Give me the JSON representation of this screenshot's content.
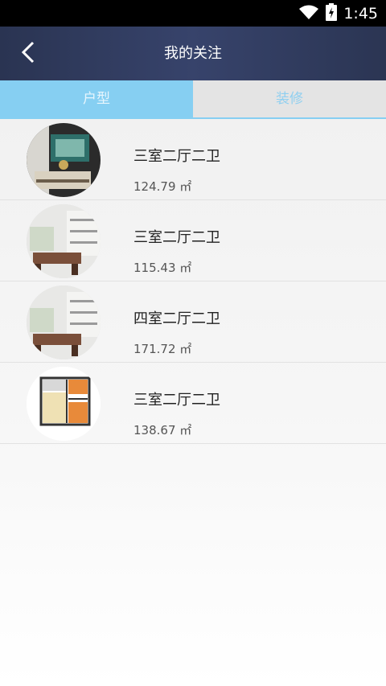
{
  "status_bar": {
    "time": "1:45",
    "icons": [
      "wifi-icon",
      "battery-icon"
    ]
  },
  "header": {
    "title": "我的关注",
    "back_icon": "chevron-left-icon"
  },
  "tabs": [
    {
      "label": "户型",
      "active": true
    },
    {
      "label": "装修",
      "active": false
    }
  ],
  "colors": {
    "header_bg": "#313c5e",
    "tab_active_bg": "#86cff2",
    "tab_inactive_bg": "#e4e4e4",
    "tab_inactive_text": "#8fcff0"
  },
  "items": [
    {
      "title": "三室二厅二卫",
      "area": "124.79 ㎡",
      "image": "dining-room-photo"
    },
    {
      "title": "三室二厅二卫",
      "area": "115.43 ㎡",
      "image": "dining-room-photo"
    },
    {
      "title": "四室二厅二卫",
      "area": "171.72 ㎡",
      "image": "dining-room-photo"
    },
    {
      "title": "三室二厅二卫",
      "area": "138.67 ㎡",
      "image": "floor-plan"
    }
  ]
}
